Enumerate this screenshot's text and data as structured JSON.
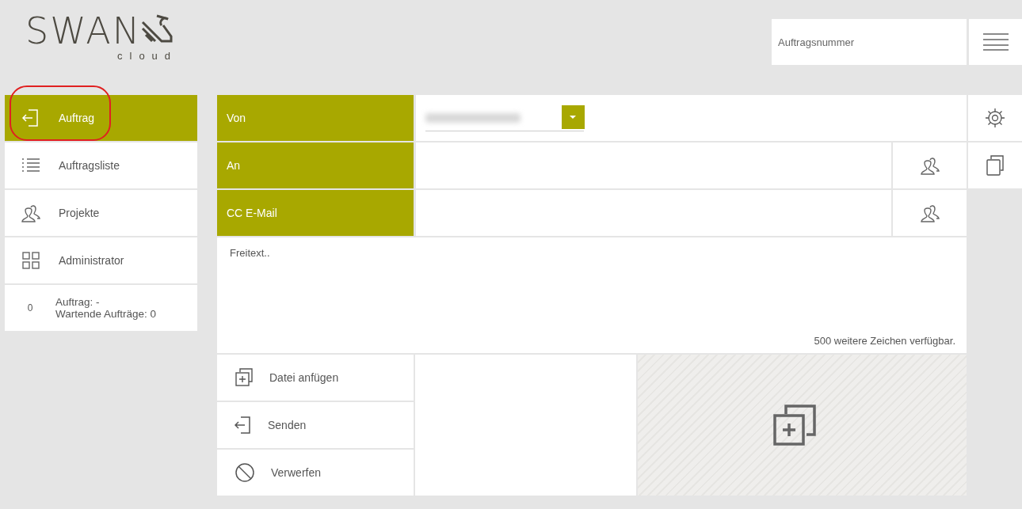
{
  "logo": {
    "wordmark": "SWAN",
    "subtitle": "cloud"
  },
  "header": {
    "order_number": {
      "placeholder": "Auftragsnummer"
    }
  },
  "sidebar": {
    "items": [
      {
        "label": "Auftrag",
        "kind": "enter",
        "selected": true,
        "circled": true
      },
      {
        "label": "Auftragsliste",
        "kind": "list",
        "selected": false,
        "circled": false
      },
      {
        "label": "Projekte",
        "kind": "people",
        "selected": false,
        "circled": false
      },
      {
        "label": "Administrator",
        "kind": "grid",
        "selected": false,
        "circled": false
      }
    ],
    "status": {
      "count": "0",
      "lines": [
        "Auftrag: -",
        "Wartende Aufträge: 0"
      ]
    }
  },
  "form": {
    "fields": [
      {
        "label": "Von",
        "kind": "dropdown"
      },
      {
        "label": "An",
        "kind": "contacts"
      },
      {
        "label": "CC E-Mail",
        "kind": "contacts"
      }
    ],
    "message": {
      "placeholder": "Freitext..",
      "counter": "500 weitere Zeichen verfügbar."
    },
    "actions": [
      {
        "label": "Datei anfügen",
        "kind": "add-file"
      },
      {
        "label": "Senden",
        "kind": "enter"
      },
      {
        "label": "Verwerfen",
        "kind": "forbidden"
      }
    ]
  }
}
